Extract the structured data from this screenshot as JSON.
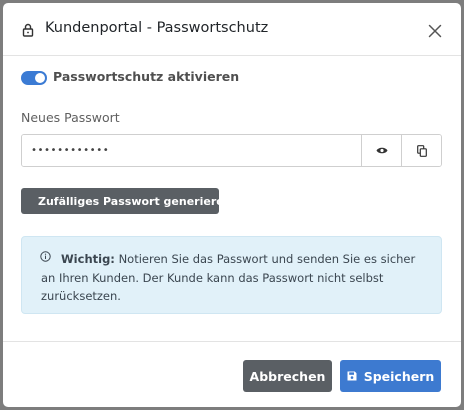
{
  "dialog": {
    "title": "Kundenportal - Passwortschutz",
    "close_icon": "close-icon",
    "lock_icon": "lock-icon"
  },
  "toggle": {
    "label": "Passwortschutz aktivieren",
    "checked": true,
    "color": "#3b7bd4"
  },
  "password": {
    "label": "Neues Passwort",
    "value": "••••••••••••",
    "show_icon": "eye-icon",
    "copy_icon": "copy-icon"
  },
  "generate_button": {
    "label": "Zufälliges Passwort generieren",
    "icon": "shuffle-icon"
  },
  "alert": {
    "icon": "info-circle-icon",
    "strong": "Wichtig:",
    "text": "Notieren Sie das Passwort und senden Sie es sicher an Ihren Kunden. Der Kunde kann das Passwort nicht selbst zurücksetzen.",
    "background": "#e1f1f9"
  },
  "footer": {
    "cancel_label": "Abbrechen",
    "save_label": "Speichern",
    "save_icon": "floppy-disk-icon",
    "save_color": "#3d7ad0",
    "cancel_color": "#5a5f64"
  }
}
